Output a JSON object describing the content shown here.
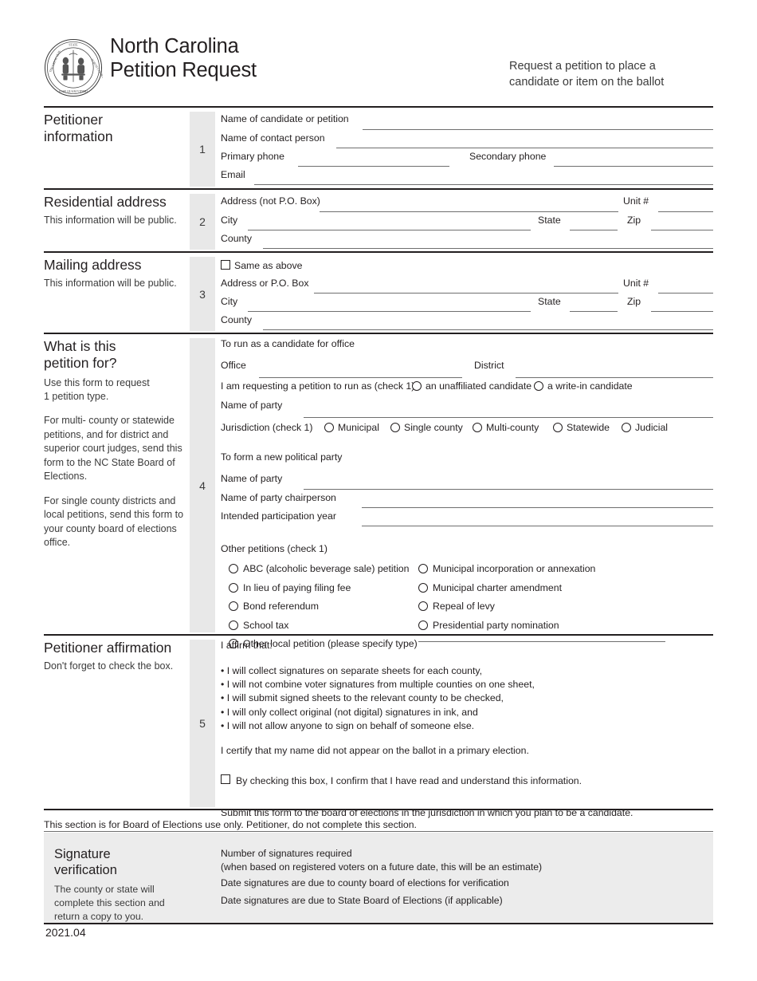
{
  "header": {
    "seal_icon": "nc-state-seal-icon",
    "title_line1": "North Carolina",
    "title_line2": "Petition Request",
    "note_line1": "Request a petition to place a",
    "note_line2": "candidate or item on the ballot"
  },
  "section1": {
    "number": "1",
    "heading_line1": "Petitioner",
    "heading_line2": "information",
    "labels": {
      "candidate_name": "Name of candidate or petition",
      "contact_person": "Name of contact person",
      "primary_phone": "Primary phone",
      "secondary_phone": "Secondary phone",
      "email": "Email"
    },
    "values": {
      "candidate_name": "",
      "contact_person": "",
      "primary_phone": "",
      "secondary_phone": "",
      "email": ""
    }
  },
  "section2": {
    "number": "2",
    "heading": "Residential address",
    "subtext": "This information will be public.",
    "labels": {
      "address": "Address (not P.O. Box)",
      "unit": "Unit #",
      "city": "City",
      "state": "State",
      "zip": "Zip",
      "county": "County"
    },
    "values": {
      "address": "",
      "unit": "",
      "city": "",
      "state": "",
      "zip": "",
      "county": ""
    }
  },
  "section3": {
    "number": "3",
    "heading": "Mailing address",
    "subtext": "This information will be public.",
    "same_as_above": "Same as above",
    "same_as_above_checked": false,
    "labels": {
      "address": "Address or P.O. Box",
      "unit": "Unit #",
      "city": "City",
      "state": "State",
      "zip": "Zip",
      "county": "County"
    },
    "values": {
      "address": "",
      "unit": "",
      "city": "",
      "state": "",
      "zip": "",
      "county": ""
    }
  },
  "section4": {
    "number": "4",
    "heading_line1": "What is this",
    "heading_line2": "petition for?",
    "instructions": [
      "Use this form to request\n1 petition type.",
      "For multi- county or statewide petitions, and for district and superior court judges, send this form to the NC State Board of Elections.",
      "For single county districts and local petitions, send this form to your county board of elections office."
    ],
    "instruction_1_line1": "Use this form to request",
    "instruction_1_line2": "1 petition type.",
    "instruction_2": "For multi- county or statewide petitions, and for district and superior court judges, send this form to the NC State Board of Elections.",
    "instruction_3": "For single county districts and local petitions, send this form to your county board of elections office.",
    "candidate_group": {
      "heading": "To run as a candidate for office",
      "office_label": "Office",
      "office_value": "",
      "district_label": "District",
      "district_value": "",
      "requesting_label": "I am requesting a petition to run as (check 1)",
      "requesting_options": [
        {
          "label": "an unaffiliated candidate",
          "selected": false
        },
        {
          "label": "a write-in candidate",
          "selected": false
        }
      ],
      "party_label": "Name of party",
      "party_value": "",
      "jurisdiction_label": "Jurisdiction (check 1)",
      "jurisdiction_options": [
        {
          "label": "Municipal",
          "selected": false
        },
        {
          "label": "Single county",
          "selected": false
        },
        {
          "label": "Multi-county",
          "selected": false
        },
        {
          "label": "Statewide",
          "selected": false
        },
        {
          "label": "Judicial",
          "selected": false
        }
      ]
    },
    "new_party_group": {
      "heading": "To form a new political party",
      "party_label": "Name of party",
      "party_value": "",
      "chairperson_label": "Name of party chairperson",
      "chairperson_value": "",
      "year_label": "Intended participation year",
      "year_value": ""
    },
    "other_group": {
      "heading": "Other petitions (check 1)",
      "left_options": [
        {
          "label": "ABC (alcoholic beverage sale) petition",
          "selected": false
        },
        {
          "label": "In lieu of paying filing fee",
          "selected": false
        },
        {
          "label": "Bond referendum",
          "selected": false
        },
        {
          "label": "School tax",
          "selected": false
        },
        {
          "label": "Other local petition (please specify type)",
          "selected": false
        }
      ],
      "right_options": [
        {
          "label": "Municipal incorporation or annexation",
          "selected": false
        },
        {
          "label": "Municipal charter amendment",
          "selected": false
        },
        {
          "label": "Repeal of levy",
          "selected": false
        },
        {
          "label": "Presidential party nomination",
          "selected": false
        }
      ],
      "other_specify_value": ""
    }
  },
  "section5": {
    "number": "5",
    "heading": "Petitioner affirmation",
    "subtext": "Don't forget to check the box.",
    "affirm_intro": "I affirm that:",
    "affirm_items": [
      "• I will collect signatures on separate sheets for each county,",
      "• I will not combine voter signatures from multiple counties on one sheet,",
      "• I will submit signed sheets to the relevant county to be checked,",
      "• I will only collect original (not digital) signatures in ink, and",
      "• I will not allow anyone to sign on behalf of someone else."
    ],
    "certify": "I certify that my name did not appear on the ballot in a primary election.",
    "confirm_checkbox_label": "By checking this box, I confirm that I have read and understand this information.",
    "confirm_checked": false,
    "submit_note": "Submit this form to the board of elections in the jurisdiction in which you plan to be a candidate."
  },
  "boe": {
    "note": "This section is for Board of Elections use only. Petitioner, do not complete this section.",
    "heading_line1": "Signature",
    "heading_line2": "verification",
    "subtext_line1": "The county or state will",
    "subtext_line2": "complete this section and",
    "subtext_line3": "return a copy to you.",
    "rows": [
      {
        "label_line1": "Number of signatures required",
        "label_line2": "(when based on registered voters on a future date, this will be an estimate)",
        "value": ""
      },
      {
        "label_line1": "Date signatures are due to county board of elections for verification",
        "label_line2": "",
        "value": ""
      },
      {
        "label_line1": "Date signatures are due to State Board of Elections (if applicable)",
        "label_line2": "",
        "value": ""
      }
    ]
  },
  "footer": {
    "version": "2021.04"
  },
  "colors": {
    "ink": "#231f20",
    "rule": "#6f6f6f",
    "badge_gray": "#e8e8e8",
    "panel_gray": "#ececec"
  }
}
